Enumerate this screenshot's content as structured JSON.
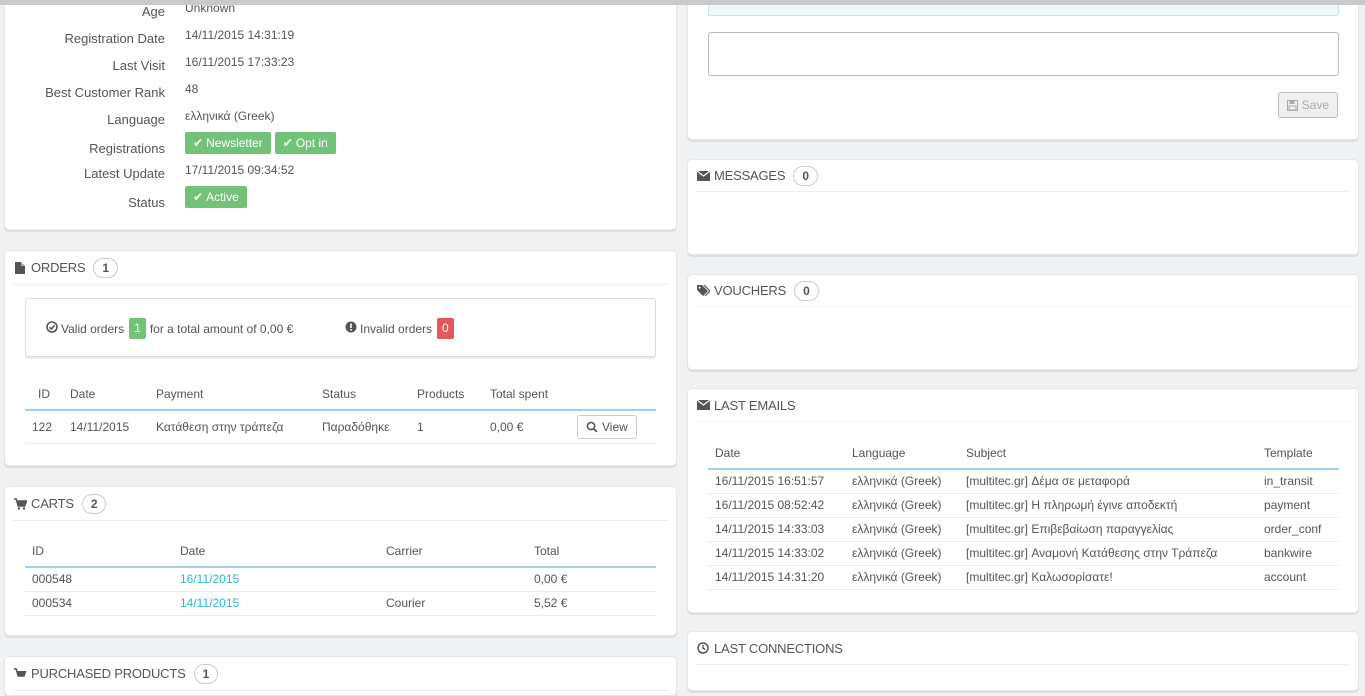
{
  "customer_info": {
    "rows": [
      {
        "label": "Age",
        "value": "Unknown"
      },
      {
        "label": "Registration Date",
        "value": "14/11/2015 14:31:19"
      },
      {
        "label": "Last Visit",
        "value": "16/11/2015 17:33:23"
      },
      {
        "label": "Best Customer Rank",
        "value": "48"
      },
      {
        "label": "Language",
        "value": "ελληνικά (Greek)"
      },
      {
        "label": "Registrations",
        "tags": [
          "Newsletter",
          "Opt in"
        ]
      },
      {
        "label": "Latest Update",
        "value": "17/11/2015 09:34:52"
      },
      {
        "label": "Status",
        "tags": [
          "Active"
        ]
      }
    ]
  },
  "orders": {
    "title": "ORDERS",
    "count": "1",
    "valid_label": "Valid orders",
    "valid_count": "1",
    "total_text": "for a total amount of 0,00 €",
    "invalid_label": "Invalid orders",
    "invalid_count": "0",
    "columns": [
      "ID",
      "Date",
      "Payment",
      "Status",
      "Products",
      "Total spent"
    ],
    "rows": [
      {
        "id": "122",
        "date": "14/11/2015",
        "payment": "Κατάθεση στην τράπεζα",
        "status": "Παραδόθηκε",
        "products": "1",
        "total": "0,00 €"
      }
    ],
    "view_label": "View"
  },
  "carts": {
    "title": "CARTS",
    "count": "2",
    "columns": [
      "ID",
      "Date",
      "Carrier",
      "Total"
    ],
    "rows": [
      {
        "id": "000548",
        "date": "16/11/2015",
        "carrier": "",
        "total": "0,00 €"
      },
      {
        "id": "000534",
        "date": "14/11/2015",
        "carrier": "Courier",
        "total": "5,52 €"
      }
    ]
  },
  "purchased": {
    "title": "PURCHASED PRODUCTS",
    "count": "1"
  },
  "note": {
    "save_label": "Save",
    "textarea_value": ""
  },
  "messages": {
    "title": "MESSAGES",
    "count": "0"
  },
  "vouchers": {
    "title": "VOUCHERS",
    "count": "0"
  },
  "last_emails": {
    "title": "LAST EMAILS",
    "columns": [
      "Date",
      "Language",
      "Subject",
      "Template"
    ],
    "rows": [
      {
        "date": "16/11/2015 16:51:57",
        "language": "ελληνικά (Greek)",
        "subject": "[multitec.gr] Δέμα σε μεταφορά",
        "template": "in_transit"
      },
      {
        "date": "16/11/2015 08:52:42",
        "language": "ελληνικά (Greek)",
        "subject": "[multitec.gr] Η πληρωμή έγινε αποδεκτή",
        "template": "payment"
      },
      {
        "date": "14/11/2015 14:33:03",
        "language": "ελληνικά (Greek)",
        "subject": "[multitec.gr] Επιβεβαίωση παραγγελίας",
        "template": "order_conf"
      },
      {
        "date": "14/11/2015 14:33:02",
        "language": "ελληνικά (Greek)",
        "subject": "[multitec.gr] Αναμονή Κατάθεσης στην Τράπεζα",
        "template": "bankwire"
      },
      {
        "date": "14/11/2015 14:31:20",
        "language": "ελληνικά (Greek)",
        "subject": "[multitec.gr] Καλωσορίσατε!",
        "template": "account"
      }
    ]
  },
  "last_connections": {
    "title": "LAST CONNECTIONS"
  },
  "colors": {
    "accent": "#25b9d7",
    "green": "#72c279",
    "red": "#e3585c",
    "table_rule": "#a0d0eb"
  }
}
